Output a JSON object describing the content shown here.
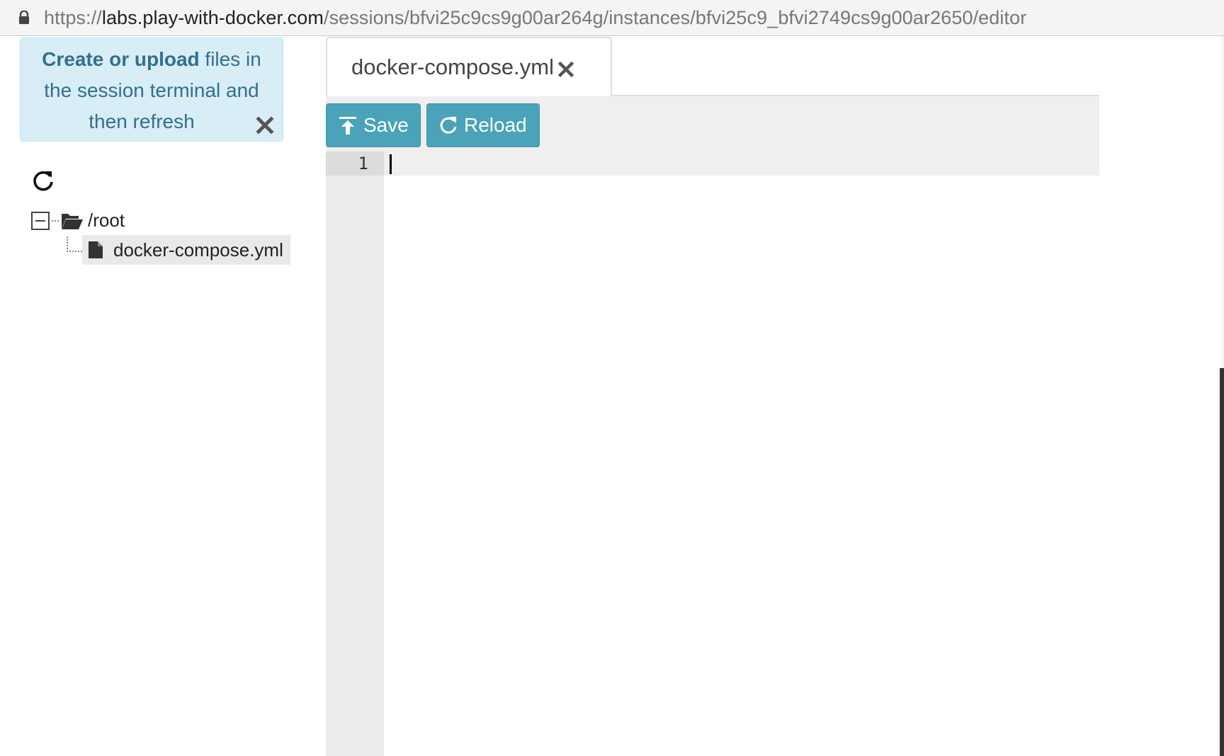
{
  "browser": {
    "url_scheme": "https://",
    "url_host": "labs.play-with-docker.com",
    "url_path": "/sessions/bfvi25c9cs9g00ar264g/instances/bfvi25c9_bfvi2749cs9g00ar2650/editor"
  },
  "sidebar": {
    "alert": {
      "bold_text": "Create or upload",
      "text_line1_rest": " files in",
      "text_line2": "the session terminal and",
      "text_line3": "then refresh"
    },
    "tree": {
      "root_label": "/root",
      "files": [
        {
          "label": "docker-compose.yml"
        }
      ]
    }
  },
  "editor": {
    "tab_label": "docker-compose.yml",
    "toolbar": {
      "save_label": "Save",
      "reload_label": "Reload"
    },
    "line_numbers": [
      "1"
    ]
  },
  "colors": {
    "accent": "#4aa3b8",
    "alert_bg": "#d9edf7",
    "alert_text": "#31708f"
  }
}
